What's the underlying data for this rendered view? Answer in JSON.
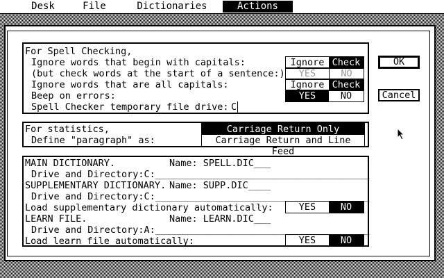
{
  "menu": {
    "items": [
      {
        "label": "Desk"
      },
      {
        "label": "File"
      },
      {
        "label": "Dictionaries"
      },
      {
        "label": "Actions"
      }
    ]
  },
  "spell": {
    "heading": "For Spell Checking,",
    "ignore_caps": "Ignore words that begin with capitals:",
    "sentence_note": "(but check words at the start of a sentence:)",
    "ignore_all_caps": "Ignore words that are all capitals:",
    "beep": "Beep on errors:",
    "temp_drive_label": "Spell Checker temporary file drive:",
    "temp_drive_value": "C",
    "opt_ignore": "Ignore",
    "opt_check": "Check",
    "opt_yes": "YES",
    "opt_no": "NO"
  },
  "stats": {
    "heading": "For statistics,",
    "define_label": "Define \"paragraph\" as:",
    "opt_cr": "Carriage Return Only",
    "opt_crlf": "Carriage Return and Line Feed"
  },
  "dicts": {
    "main_label": "MAIN DICTIONARY.",
    "main_name": "Name: SPELL.DIC___",
    "main_dir": "Drive and Directory:C:______________________________________",
    "supp_label": "SUPPLEMENTARY DICTIONARY.",
    "supp_name": "Name: SUPP.DIC____",
    "supp_dir": "Drive and Directory:C:______________________________________",
    "supp_auto": "Load supplementary dictionary automatically:",
    "learn_label": "LEARN FILE.",
    "learn_name": "Name: LEARN.DIC___",
    "learn_dir": "Drive and Directory:A:______________________________________",
    "learn_auto": "Load learn file automatically:",
    "opt_yes": "YES",
    "opt_no": "NO"
  },
  "buttons": {
    "ok": "OK",
    "cancel": "Cancel"
  }
}
